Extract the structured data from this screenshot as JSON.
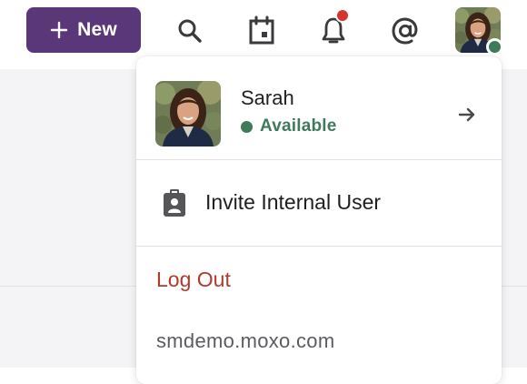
{
  "header": {
    "new_button_label": "New",
    "icons": [
      "search-icon",
      "calendar-icon",
      "bell-icon",
      "at-mention-icon"
    ],
    "notification_badge_color": "#d9342c",
    "accent_color": "#5a3778"
  },
  "user_menu": {
    "name": "Sarah",
    "status": "Available",
    "status_color": "#3f7a5a",
    "invite_label": "Invite Internal User",
    "logout_label": "Log Out",
    "logout_color": "#b03a2e",
    "domain": "smdemo.moxo.com"
  }
}
